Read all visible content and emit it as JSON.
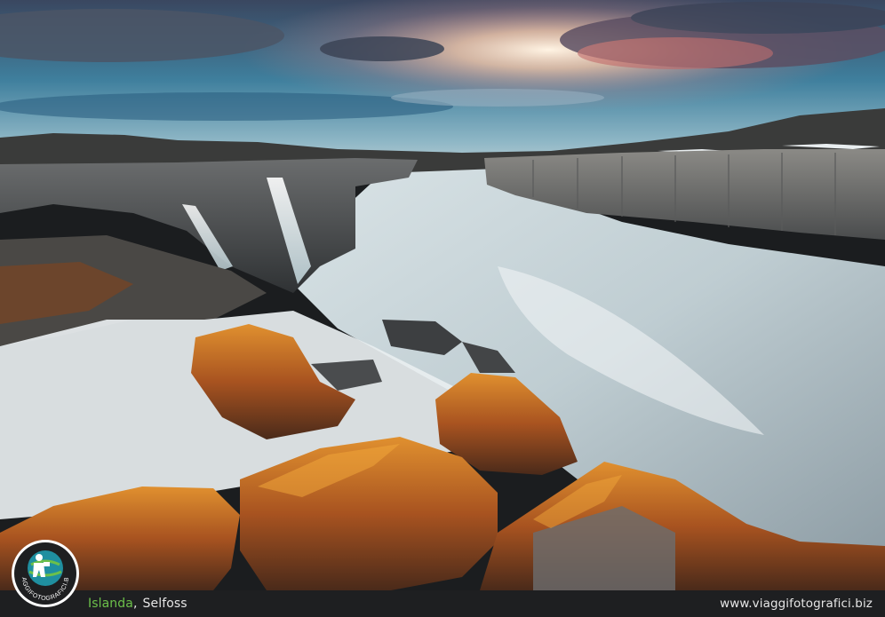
{
  "caption": {
    "country": "Islanda",
    "separator": ",",
    "place": "Selfoss",
    "website": "www.viaggifotografici.biz"
  },
  "logo": {
    "text": "VIAGGIFOTOGRAFICI.BIZ",
    "icon": "photographer-globe-icon"
  },
  "photo": {
    "subject": "canyon-waterfall-river-sunset"
  },
  "colors": {
    "accent_green": "#6cc04a",
    "bar_bg": "#1e1f21",
    "logo_teal": "#1f8fa0"
  }
}
